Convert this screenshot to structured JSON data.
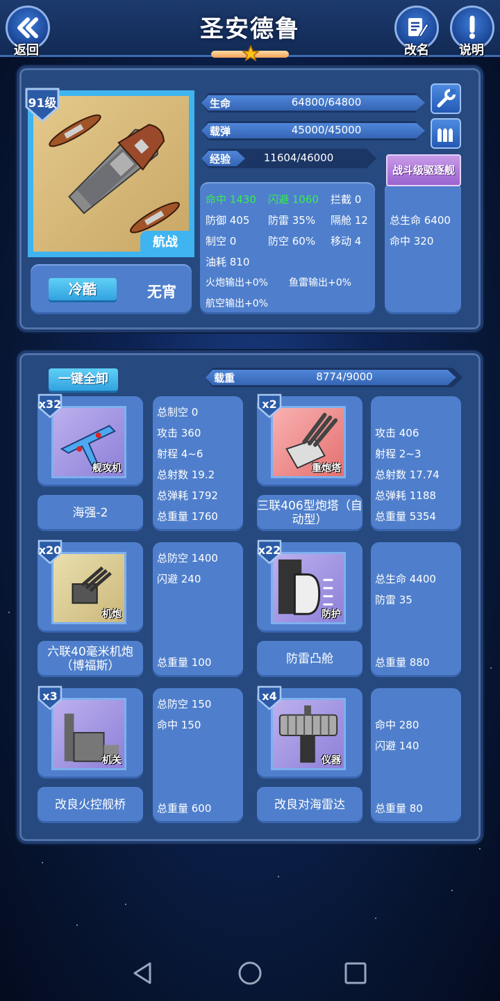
{
  "header": {
    "back_label": "返回",
    "title": "圣安德鲁",
    "rename_label": "改名",
    "info_label": "说明",
    "stars": 1
  },
  "ship": {
    "level": "91级",
    "type": "航战",
    "skill_button": "冷酷",
    "skill_value": "无宵",
    "bars": {
      "hp": {
        "label": "生命",
        "value": "64800/64800",
        "fraction": 1.0
      },
      "ammo": {
        "label": "载弹",
        "value": "45000/45000",
        "fraction": 1.0
      },
      "exp": {
        "label": "经验",
        "value": "11604/46000",
        "fraction": 0.25
      }
    },
    "stats": {
      "hit": "命中 1430",
      "evade": "闪避 1060",
      "intercept": "拦截 0",
      "defense": "防御 405",
      "torp_def": "防雷 35%",
      "bulkhead": "隔舱 12",
      "air_control": "制空 0",
      "aa": "防空 60%",
      "move": "移动 4",
      "fuel": "油耗 810",
      "gun_out": "火炮输出+0%",
      "torp_out": "鱼雷输出+0%",
      "air_out": "航空输出+0%"
    },
    "class_badge": "战斗级驱逐舰",
    "bonus": {
      "hp": "总生命 6400",
      "hit": "命中 320"
    }
  },
  "equipment": {
    "unload_all": "一键全卸",
    "load": {
      "label": "载重",
      "value": "8774/9000",
      "fraction": 0.975
    },
    "items": [
      {
        "count": "x32",
        "category": "舰攻机",
        "name": "海强-2",
        "stats": [
          "总制空 0",
          "攻击 360",
          "射程 4~6",
          "总射数 19.2",
          "总弹耗 1792",
          "总重量 1760"
        ]
      },
      {
        "count": "x2",
        "category": "重炮塔",
        "name": "三联406型炮塔（自动型）",
        "stats": [
          "攻击 406",
          "射程 2~3",
          "总射数 17.74",
          "总弹耗 1188",
          "总重量 5354"
        ]
      },
      {
        "count": "x20",
        "category": "机炮",
        "name": "六联40毫米机炮（博福斯）",
        "stats": [
          "总防空 1400",
          "闪避 240",
          "总重量 100"
        ]
      },
      {
        "count": "x22",
        "category": "防护",
        "name": "防雷凸舱",
        "stats": [
          "总生命 4400",
          "防雷 35",
          "总重量 880"
        ]
      },
      {
        "count": "x3",
        "category": "机关",
        "name": "改良火控舰桥",
        "stats": [
          "总防空 150",
          "命中 150",
          "总重量 600"
        ]
      },
      {
        "count": "x4",
        "category": "仪器",
        "name": "改良对海雷达",
        "stats": [
          "命中 280",
          "闪避 140",
          "总重量 80"
        ]
      }
    ]
  },
  "colors": {
    "accent": "#3fb4f0",
    "panel": "#4f7fcc",
    "green": "#35ef4a",
    "badge": "#b27fe0"
  }
}
